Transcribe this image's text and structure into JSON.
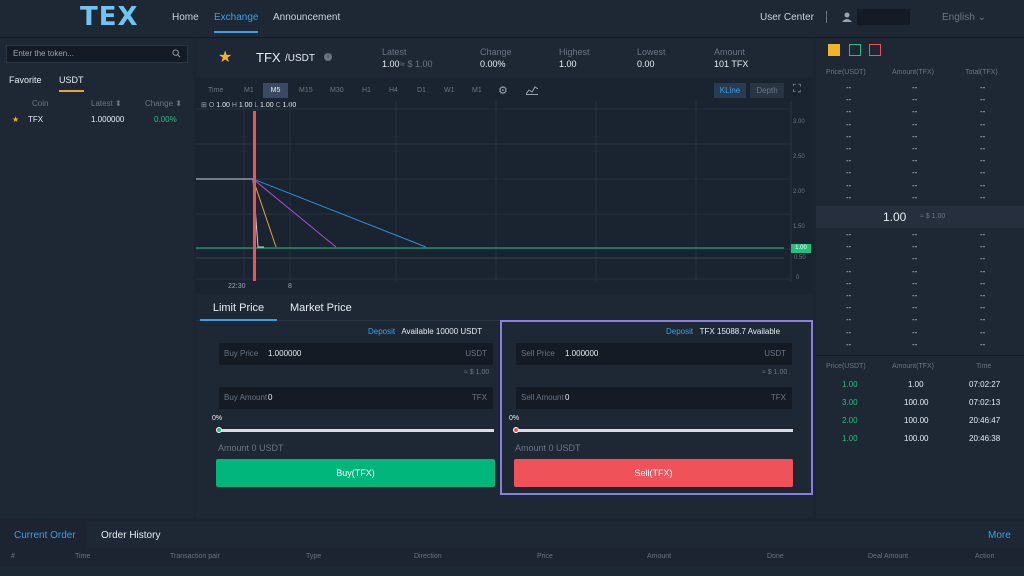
{
  "brand": {
    "logo": "TEX"
  },
  "nav": {
    "home": "Home",
    "exchange": "Exchange",
    "announcement": "Announcement",
    "user_center": "User Center",
    "language": "English"
  },
  "left": {
    "search_placeholder": "Enter the token...",
    "tab_favorite": "Favorite",
    "tab_usdt": "USDT",
    "col_coin": "Coin",
    "col_latest": "Latest",
    "col_change": "Change",
    "rows": [
      {
        "coin": "TFX",
        "latest": "1.000000",
        "change": "0.00%"
      }
    ]
  },
  "ticker": {
    "pair": "TFX",
    "quote": "/USDT",
    "latest_label": "Latest",
    "latest_value": "1.00",
    "latest_usd": "≈ $ 1.00",
    "change_label": "Change",
    "change_value": "0.00%",
    "high_label": "Highest",
    "high_value": "1.00",
    "low_label": "Lowest",
    "low_value": "0.00",
    "amount_label": "Amount",
    "amount_value": "101 TFX"
  },
  "chart": {
    "timeframes": [
      "Time",
      "M1",
      "M5",
      "M15",
      "M30",
      "H1",
      "H4",
      "D1",
      "W1",
      "M1"
    ],
    "active_timeframe": "M5",
    "kline": "KLine",
    "depth": "Depth",
    "ohlc": {
      "o_label": "O",
      "o": "1.00",
      "h_label": "H",
      "h": "1.00",
      "l_label": "L",
      "l": "1.00",
      "c_label": "C",
      "c": "1.00"
    },
    "y_ticks": [
      "3.00",
      "2.50",
      "2.00",
      "1.50",
      "1.00",
      "0.50",
      "0"
    ],
    "price_marker": "1.00",
    "x_ticks": [
      "22:30",
      "8"
    ]
  },
  "trade": {
    "tab_limit": "Limit Price",
    "tab_market": "Market Price",
    "buy": {
      "deposit": "Deposit",
      "available": "Available",
      "avail_value": "10000",
      "avail_unit": "USDT",
      "price_label": "Buy Price",
      "price_value": "1.000000",
      "price_unit": "USDT",
      "usd": "≈ $ 1.00",
      "amount_label": "Buy Amount",
      "amount_value": "0",
      "amount_unit": "TFX",
      "pct": "0%",
      "total": "Amount 0 USDT",
      "button": "Buy(TFX)"
    },
    "sell": {
      "deposit": "Deposit",
      "avail_unit": "TFX",
      "avail_value": "15088.7",
      "available": "Available",
      "price_label": "Sell Price",
      "price_value": "1.000000",
      "price_unit": "USDT",
      "usd": "≈ $ 1.00",
      "amount_label": "Sell Amount",
      "amount_value": "0",
      "amount_unit": "TFX",
      "pct": "0%",
      "total": "Amount 0 USDT",
      "button": "Sell(TFX)"
    }
  },
  "book": {
    "col_price": "Price(USDT)",
    "col_amount": "Amount(TFX)",
    "col_total": "Total(TFX)",
    "placeholder": "--",
    "mid_price": "1.00",
    "mid_usd": "≈ $ 1.00",
    "trades_col_price": "Price(USDT)",
    "trades_col_amount": "Amount(TFX)",
    "trades_col_time": "Time",
    "trades": [
      {
        "price": "1.00",
        "amount": "1.00",
        "time": "07:02:27"
      },
      {
        "price": "3.00",
        "amount": "100.00",
        "time": "07:02:13"
      },
      {
        "price": "2.00",
        "amount": "100.00",
        "time": "20:46:47"
      },
      {
        "price": "1.00",
        "amount": "100.00",
        "time": "20:46:38"
      }
    ]
  },
  "orders": {
    "tab_current": "Current Order",
    "tab_history": "Order History",
    "more": "More",
    "cols": [
      "#",
      "Time",
      "Transaction pair",
      "Type",
      "Direction",
      "Price",
      "Amount",
      "Done",
      "Deal Amount",
      "Action"
    ]
  },
  "colors": {
    "accent": "#3b9fe8",
    "buy": "#00b67a",
    "sell": "#f0525a",
    "favorite": "#f0b429"
  }
}
